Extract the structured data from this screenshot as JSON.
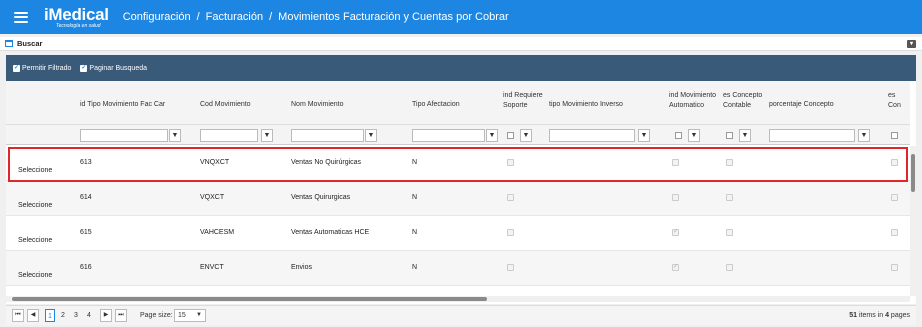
{
  "app": {
    "logo": "iMedical",
    "logo_tagline": "Tecnología en salud",
    "breadcrumb": [
      "Configuración",
      "/",
      "Facturación",
      "/",
      "Movimientos Facturación y Cuentas por Cobrar"
    ]
  },
  "panel": {
    "title": "Buscar"
  },
  "options": {
    "filter_label": "Permitir Filtrado",
    "paging_label": "Paginar Busqueda"
  },
  "columns": [
    "id Tipo Movimiento Fac Car",
    "Cod Movimiento",
    "Nom Movimiento",
    "Tipo Afectacion",
    "ind Requiere Soporte",
    "tipo Movimiento Inverso",
    "ind Movimiento Automatico",
    "es Concepto Contable",
    "porcentaje Concepto",
    "es Con"
  ],
  "rows": [
    {
      "action": "Seleccione",
      "id": "613",
      "cod": "VNQXCT",
      "nom": "Ventas No Quirúrgicas",
      "tipo": "N",
      "soporte": false,
      "automatico": false,
      "contable": false,
      "con": false
    },
    {
      "action": "Seleccione",
      "id": "614",
      "cod": "VQXCT",
      "nom": "Ventas Quirurgicas",
      "tipo": "N",
      "soporte": false,
      "automatico": false,
      "contable": false,
      "con": false
    },
    {
      "action": "Seleccione",
      "id": "615",
      "cod": "VAHCESM",
      "nom": "Ventas Automaticas HCE",
      "tipo": "N",
      "soporte": false,
      "automatico": true,
      "contable": false,
      "con": false
    },
    {
      "action": "Seleccione",
      "id": "616",
      "cod": "ENVCT",
      "nom": "Envios",
      "tipo": "N",
      "soporte": false,
      "automatico": true,
      "contable": false,
      "con": false
    }
  ],
  "pager": {
    "pages": [
      "1",
      "2",
      "3",
      "4"
    ],
    "current_page": "1",
    "page_size_label": "Page size:",
    "page_size": "15",
    "total_items": "51",
    "items_in_label": "items in",
    "total_pages": "4",
    "pages_label": "pages"
  },
  "colors": {
    "topbar": "#1d86e3",
    "options_bar": "#3a5a7a",
    "highlight": "#e0262c"
  }
}
